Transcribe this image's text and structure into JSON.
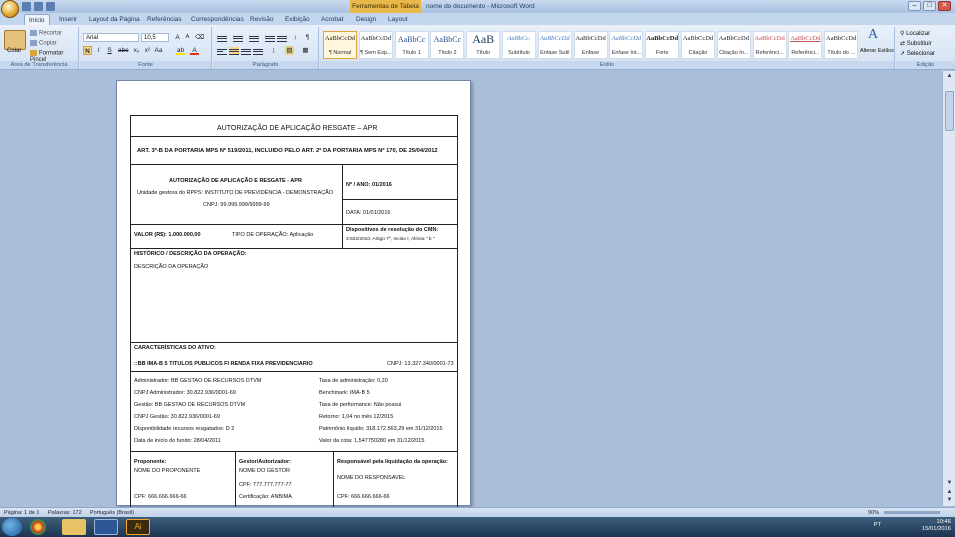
{
  "window": {
    "title": "nome do documento - Microsoft Word",
    "context_tab": "Ferramentas de Tabela"
  },
  "tabs": [
    "Início",
    "Inserir",
    "Layout da Página",
    "Referências",
    "Correspondências",
    "Revisão",
    "Exibição",
    "Acrobat",
    "Design",
    "Layout"
  ],
  "ribbon": {
    "clipboard": {
      "paste": "Colar",
      "cut": "Recortar",
      "copy": "Copiar",
      "format_painter": "Formatar Pincel",
      "label": "Área de Transferência"
    },
    "font": {
      "name": "Arial",
      "size": "10,5",
      "label": "Fonte"
    },
    "paragraph": {
      "label": "Parágrafo"
    },
    "styles": {
      "label": "Estilo",
      "items": [
        {
          "sample": "AaBbCcDd",
          "name": "¶ Normal"
        },
        {
          "sample": "AaBbCcDd",
          "name": "¶ Sem Esp..."
        },
        {
          "sample": "AaBbCc",
          "name": "Título 1"
        },
        {
          "sample": "AaBbCc",
          "name": "Título 2"
        },
        {
          "sample": "AaB",
          "name": "Título"
        },
        {
          "sample": "AaBbCc.",
          "name": "Subtítulo"
        },
        {
          "sample": "AaBbCcDd",
          "name": "Ênfase Sutil"
        },
        {
          "sample": "AaBbCcDd",
          "name": "Ênfase"
        },
        {
          "sample": "AaBbCcDd",
          "name": "Ênfase Int..."
        },
        {
          "sample": "AaBbCcDd",
          "name": "Forte"
        },
        {
          "sample": "AaBbCcDd",
          "name": "Citação"
        },
        {
          "sample": "AaBbCcDd",
          "name": "Citação In..."
        },
        {
          "sample": "AaBbCcDd",
          "name": "Referênci..."
        },
        {
          "sample": "AaBbCcDd",
          "name": "Referênci..."
        },
        {
          "sample": "AaBbCcDd",
          "name": "Título do ..."
        }
      ]
    },
    "change_styles": "Alterar Estilos",
    "editing": {
      "find": "Localizar",
      "replace": "Substituir",
      "select": "Selecionar",
      "label": "Edição"
    }
  },
  "doc": {
    "title": "AUTORIZAÇÃO DE APLICAÇÃO RESGATE – APR",
    "subtitle": "ART. 3º-B DA PORTARIA MPS Nº 519/2011, INCLUIDO PELO ART. 2º DA PORTARIA MPS Nº 170, DE 25/04/2012",
    "head_title": "AUTORIZAÇÃO DE APLICAÇÃO E RESGATE - APR",
    "unit": "Unidade gestora do RPPS: INSTITUTO DE PREVIDÊNCIA - DEMONSTRAÇÃO",
    "cnpj": "CNPJ: 99.999.999/9999-99",
    "n_ano": "Nº / ANO: 01/2016",
    "data": "DATA: 01/01/2016",
    "valor": "VALOR (R$): 1.000.000,00",
    "tipo": "TIPO DE OPERAÇÃO: Aplicação",
    "dispositivos_label": "Dispositivos de resolução do CMN:",
    "dispositivos": "3.922/2010, Artigo 7º, Inciso I, Alínea \" b \"",
    "historico_label": "HISTÓRICO / DESCRIÇÃO DA OPERAÇÃO:",
    "historico": "DESCRIÇÃO DA OPERAÇÃO",
    "caracteristicas_label": "CARACTERÍSTICAS DO ATIVO:",
    "ativo": "::BB IMA-B 5 TITULOS PUBLICOS FI RENDA FIXA PREVIDENCIARIO",
    "ativo_cnpj": "CNPJ: 13.327.340/0001-73",
    "left_fields": [
      "Administrador: BB GESTAO DE RECURSOS DTVM",
      "CNPJ Administrador: 30.822.936/0001-69",
      "Gestão: BB GESTAO DE RECURSOS DTVM",
      "CNPJ Gestão: 30.822.936/0001-69",
      "Disponibilidade recursos resgatados: D 2",
      "Data de início do fundo: 28/04/2011"
    ],
    "right_fields": [
      "Taxa de administração: 0,20",
      "Benchmark: IMA-B 5",
      "Taxa de performance: Não possui",
      "Retorno: 1,04 no mês 12/2015",
      "Patrimônio líquido: 318.172.563,29 em 31/12/2015",
      "Valor da cota: 1,547750280 em 31/12/2015"
    ],
    "proponente_label": "Proponente:",
    "proponente": "NOME DO PROPONENTE",
    "proponente_cpf": "CPF: 666.666.666-66",
    "gestor_label": "Gestor/Autorizador:",
    "gestor": "NOME DO GESTOR",
    "gestor_cpf": "CPF: 777.777.777-77",
    "gestor_cert": "Certificação: ANBIMA",
    "responsavel_label": "Responsável pela liquidação da operação:",
    "responsavel": "NOME DO RESPONSAVEL",
    "responsavel_cpf": "CPF: 666.666.666-66"
  },
  "status": {
    "page": "Página: 1 de 1",
    "words": "Palavras: 172",
    "lang": "Português (Brasil)",
    "zoom": "90%"
  },
  "taskbar": {
    "lang": "PT",
    "time": "10:46",
    "date": "15/01/2016"
  }
}
